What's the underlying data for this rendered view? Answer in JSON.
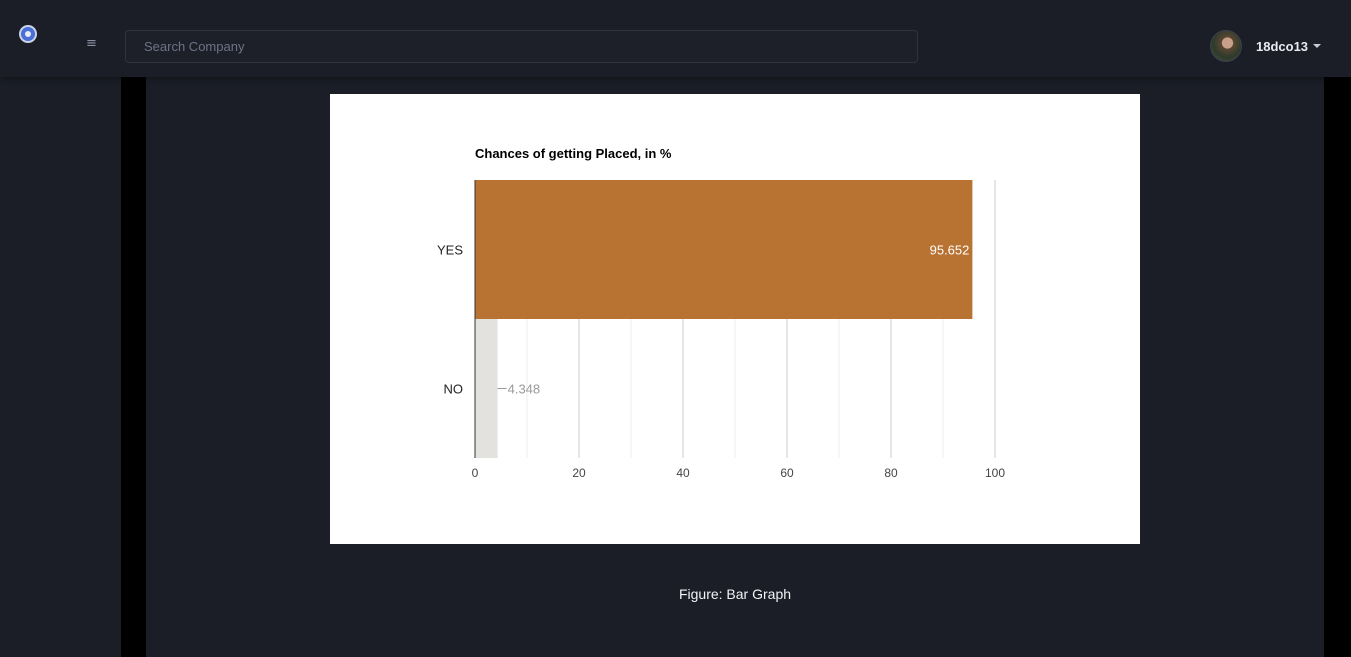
{
  "header": {
    "search_placeholder": "Search Company",
    "username": "18dco13",
    "icons": {
      "logo": "app-logo-icon",
      "menu": "hamburger-menu-icon",
      "caret": "caret-down-icon"
    }
  },
  "colors": {
    "background": "#1b1e27",
    "bar_yes": "#b87333",
    "bar_no": "#e4e2df",
    "caption_text": "#f2f3f6"
  },
  "figure": {
    "caption": "Figure: Bar Graph"
  },
  "chart_data": {
    "type": "bar",
    "orientation": "horizontal",
    "title": "Chances of getting Placed, in %",
    "categories": [
      "YES",
      "NO"
    ],
    "values": [
      95.652,
      4.348
    ],
    "value_labels": [
      "95.652",
      "4.348"
    ],
    "bar_colors": [
      "#b87333",
      "#e4e2df"
    ],
    "xlim": [
      0,
      100
    ],
    "xticks": [
      0,
      20,
      40,
      60,
      80,
      100
    ],
    "xlabel": "",
    "ylabel": "",
    "grid": true
  }
}
